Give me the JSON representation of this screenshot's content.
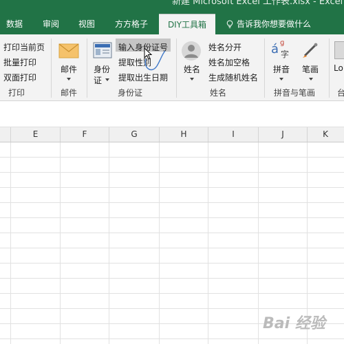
{
  "window": {
    "title_partial": "新建 Microsoft Excel 工作表.xlsx - Excel"
  },
  "tabs": [
    {
      "label": "数据",
      "active": false
    },
    {
      "label": "审阅",
      "active": false
    },
    {
      "label": "视图",
      "active": false
    },
    {
      "label": "方方格子",
      "active": false
    },
    {
      "label": "DIY工具箱",
      "active": true
    },
    {
      "label": "告诉我你想要做什么",
      "active": false,
      "icon": "lightbulb-icon"
    }
  ],
  "ribbon": {
    "print_group": {
      "items": [
        "打印当前页",
        "批量打印",
        "双面打印"
      ],
      "label": "打印"
    },
    "mail_group": {
      "button_label": "邮件",
      "label": "邮件",
      "icon": "envelope-icon"
    },
    "id_group": {
      "big_button": [
        "身份",
        "证"
      ],
      "items": [
        "输入身份证号",
        "提取性别",
        "提取出生日期"
      ],
      "label": "身份证",
      "icon": "id-card-icon"
    },
    "name_group": {
      "big_button": "姓名",
      "items": [
        "姓名分开",
        "姓名加空格",
        "生成随机姓名"
      ],
      "label": "姓名",
      "icon": "person-icon"
    },
    "pinyin_group": {
      "buttons": [
        "拼音",
        "笔画"
      ],
      "label": "拼音与笔画",
      "icons": [
        "pinyin-icon",
        "brush-icon"
      ]
    },
    "partial_group": {
      "button_fragment": "Lo",
      "label_fragment": "台"
    }
  },
  "columns": [
    "E",
    "F",
    "G",
    "H",
    "I",
    "J",
    "K"
  ],
  "watermark": "Bai 经验",
  "colors": {
    "excel_green": "#217346",
    "ribbon_bg": "#f3f3f3",
    "selected_item": "#c5c5c5"
  }
}
